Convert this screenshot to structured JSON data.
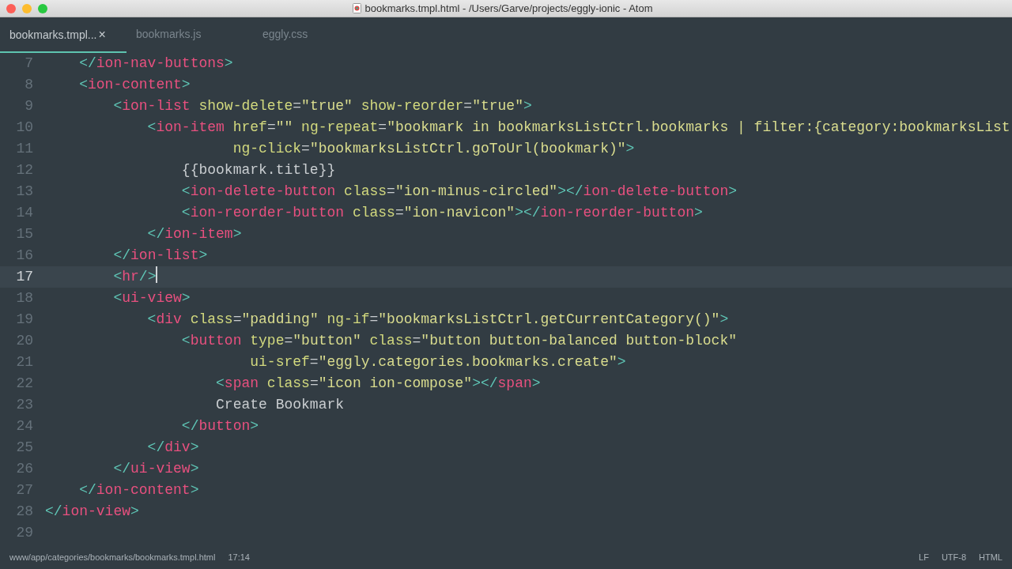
{
  "window": {
    "title": "bookmarks.tmpl.html - /Users/Garve/projects/eggly-ionic - Atom"
  },
  "tabs": [
    {
      "label": "bookmarks.tmpl...",
      "selected": true,
      "close": "×"
    },
    {
      "label": "bookmarks.js",
      "selected": false
    },
    {
      "label": "eggly.css",
      "selected": false
    }
  ],
  "editor": {
    "lines": [
      {
        "number": "7",
        "current": false,
        "tokens": [
          {
            "kind": "punct",
            "text": "    </"
          },
          {
            "kind": "tag",
            "text": "ion-nav-buttons"
          },
          {
            "kind": "punct",
            "text": ">"
          }
        ]
      },
      {
        "number": "8",
        "current": false,
        "tokens": [
          {
            "kind": "punct",
            "text": "    <"
          },
          {
            "kind": "tag",
            "text": "ion-content"
          },
          {
            "kind": "punct",
            "text": ">"
          }
        ]
      },
      {
        "number": "9",
        "current": false,
        "tokens": [
          {
            "kind": "punct",
            "text": "        <"
          },
          {
            "kind": "tag",
            "text": "ion-list"
          },
          {
            "kind": "attr",
            "text": " show-delete"
          },
          {
            "kind": "text",
            "text": "="
          },
          {
            "kind": "string",
            "text": "\"true\""
          },
          {
            "kind": "attr",
            "text": " show-reorder"
          },
          {
            "kind": "text",
            "text": "="
          },
          {
            "kind": "string",
            "text": "\"true\""
          },
          {
            "kind": "punct",
            "text": ">"
          }
        ]
      },
      {
        "number": "10",
        "current": false,
        "tokens": [
          {
            "kind": "punct",
            "text": "            <"
          },
          {
            "kind": "tag",
            "text": "ion-item"
          },
          {
            "kind": "attr",
            "text": " href"
          },
          {
            "kind": "text",
            "text": "="
          },
          {
            "kind": "string",
            "text": "\"\""
          },
          {
            "kind": "attr",
            "text": " ng-repeat"
          },
          {
            "kind": "text",
            "text": "="
          },
          {
            "kind": "string",
            "text": "\"bookmark in bookmarksListCtrl.bookmarks | filter:{category:bookmarksList"
          }
        ]
      },
      {
        "number": "11",
        "current": false,
        "tokens": [
          {
            "kind": "attr",
            "text": "                      ng-click"
          },
          {
            "kind": "text",
            "text": "="
          },
          {
            "kind": "string",
            "text": "\"bookmarksListCtrl.goToUrl(bookmark)\""
          },
          {
            "kind": "punct",
            "text": ">"
          }
        ]
      },
      {
        "number": "12",
        "current": false,
        "tokens": [
          {
            "kind": "text",
            "text": "                {{bookmark.title}}"
          }
        ]
      },
      {
        "number": "13",
        "current": false,
        "tokens": [
          {
            "kind": "punct",
            "text": "                <"
          },
          {
            "kind": "tag",
            "text": "ion-delete-button"
          },
          {
            "kind": "attr",
            "text": " class"
          },
          {
            "kind": "text",
            "text": "="
          },
          {
            "kind": "string",
            "text": "\"ion-minus-circled\""
          },
          {
            "kind": "punct",
            "text": "></"
          },
          {
            "kind": "tag",
            "text": "ion-delete-button"
          },
          {
            "kind": "punct",
            "text": ">"
          }
        ]
      },
      {
        "number": "14",
        "current": false,
        "tokens": [
          {
            "kind": "punct",
            "text": "                <"
          },
          {
            "kind": "tag",
            "text": "ion-reorder-button"
          },
          {
            "kind": "attr",
            "text": " class"
          },
          {
            "kind": "text",
            "text": "="
          },
          {
            "kind": "string",
            "text": "\"ion-navicon\""
          },
          {
            "kind": "punct",
            "text": "></"
          },
          {
            "kind": "tag",
            "text": "ion-reorder-button"
          },
          {
            "kind": "punct",
            "text": ">"
          }
        ]
      },
      {
        "number": "15",
        "current": false,
        "tokens": [
          {
            "kind": "punct",
            "text": "            </"
          },
          {
            "kind": "tag",
            "text": "ion-item"
          },
          {
            "kind": "punct",
            "text": ">"
          }
        ]
      },
      {
        "number": "16",
        "current": false,
        "tokens": [
          {
            "kind": "punct",
            "text": "        </"
          },
          {
            "kind": "tag",
            "text": "ion-list"
          },
          {
            "kind": "punct",
            "text": ">"
          }
        ]
      },
      {
        "number": "17",
        "current": true,
        "tokens": [
          {
            "kind": "punct",
            "text": "        <"
          },
          {
            "kind": "tag",
            "text": "hr"
          },
          {
            "kind": "punct",
            "text": "/>"
          }
        ]
      },
      {
        "number": "18",
        "current": false,
        "tokens": [
          {
            "kind": "punct",
            "text": "        <"
          },
          {
            "kind": "tag",
            "text": "ui-view"
          },
          {
            "kind": "punct",
            "text": ">"
          }
        ]
      },
      {
        "number": "19",
        "current": false,
        "tokens": [
          {
            "kind": "punct",
            "text": "            <"
          },
          {
            "kind": "tag",
            "text": "div"
          },
          {
            "kind": "attr",
            "text": " class"
          },
          {
            "kind": "text",
            "text": "="
          },
          {
            "kind": "string",
            "text": "\"padding\""
          },
          {
            "kind": "attr",
            "text": " ng-if"
          },
          {
            "kind": "text",
            "text": "="
          },
          {
            "kind": "string",
            "text": "\"bookmarksListCtrl.getCurrentCategory()\""
          },
          {
            "kind": "punct",
            "text": ">"
          }
        ]
      },
      {
        "number": "20",
        "current": false,
        "tokens": [
          {
            "kind": "punct",
            "text": "                <"
          },
          {
            "kind": "tag",
            "text": "button"
          },
          {
            "kind": "attr",
            "text": " type"
          },
          {
            "kind": "text",
            "text": "="
          },
          {
            "kind": "string",
            "text": "\"button\""
          },
          {
            "kind": "attr",
            "text": " class"
          },
          {
            "kind": "text",
            "text": "="
          },
          {
            "kind": "string",
            "text": "\"button button-balanced button-block\""
          }
        ]
      },
      {
        "number": "21",
        "current": false,
        "tokens": [
          {
            "kind": "attr",
            "text": "                        ui-sref"
          },
          {
            "kind": "text",
            "text": "="
          },
          {
            "kind": "string",
            "text": "\"eggly.categories.bookmarks.create\""
          },
          {
            "kind": "punct",
            "text": ">"
          }
        ]
      },
      {
        "number": "22",
        "current": false,
        "tokens": [
          {
            "kind": "punct",
            "text": "                    <"
          },
          {
            "kind": "tag",
            "text": "span"
          },
          {
            "kind": "attr",
            "text": " class"
          },
          {
            "kind": "text",
            "text": "="
          },
          {
            "kind": "string",
            "text": "\"icon ion-compose\""
          },
          {
            "kind": "punct",
            "text": "></"
          },
          {
            "kind": "tag",
            "text": "span"
          },
          {
            "kind": "punct",
            "text": ">"
          }
        ]
      },
      {
        "number": "23",
        "current": false,
        "tokens": [
          {
            "kind": "text",
            "text": "                    Create Bookmark"
          }
        ]
      },
      {
        "number": "24",
        "current": false,
        "tokens": [
          {
            "kind": "punct",
            "text": "                </"
          },
          {
            "kind": "tag",
            "text": "button"
          },
          {
            "kind": "punct",
            "text": ">"
          }
        ]
      },
      {
        "number": "25",
        "current": false,
        "tokens": [
          {
            "kind": "punct",
            "text": "            </"
          },
          {
            "kind": "tag",
            "text": "div"
          },
          {
            "kind": "punct",
            "text": ">"
          }
        ]
      },
      {
        "number": "26",
        "current": false,
        "tokens": [
          {
            "kind": "punct",
            "text": "        </"
          },
          {
            "kind": "tag",
            "text": "ui-view"
          },
          {
            "kind": "punct",
            "text": ">"
          }
        ]
      },
      {
        "number": "27",
        "current": false,
        "tokens": [
          {
            "kind": "punct",
            "text": "    </"
          },
          {
            "kind": "tag",
            "text": "ion-content"
          },
          {
            "kind": "punct",
            "text": ">"
          }
        ]
      },
      {
        "number": "28",
        "current": false,
        "tokens": [
          {
            "kind": "punct",
            "text": "</"
          },
          {
            "kind": "tag",
            "text": "ion-view"
          },
          {
            "kind": "punct",
            "text": ">"
          }
        ]
      },
      {
        "number": "29",
        "current": false
      }
    ]
  },
  "status_bar": {
    "path": "www/app/categories/bookmarks/bookmarks.tmpl.html",
    "position": "17:14",
    "line_ending": "LF",
    "encoding": "UTF-8",
    "grammar": "HTML"
  }
}
